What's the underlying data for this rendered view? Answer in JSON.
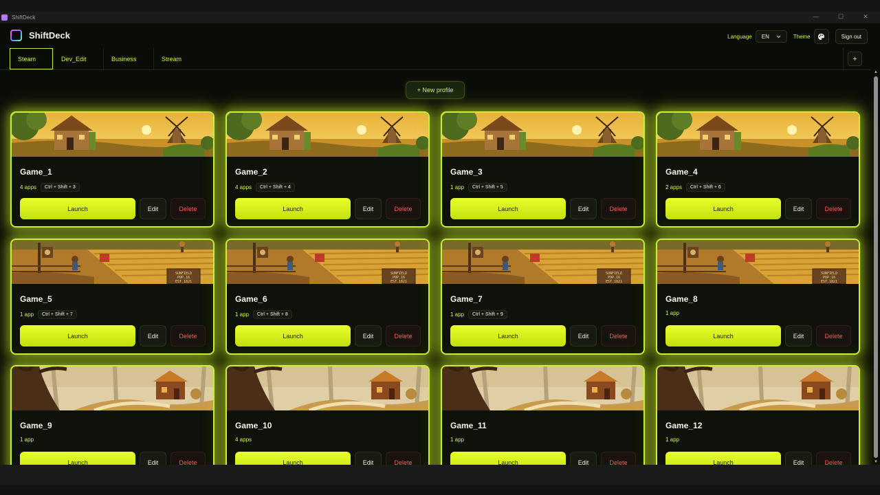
{
  "window": {
    "title": "ShiftDeck",
    "controls": [
      "—",
      "☐",
      "✕"
    ]
  },
  "header": {
    "brand": "ShiftDeck",
    "language_label": "Language",
    "language_value": "EN",
    "theme_label": "Theme",
    "signout_label": "Sign out"
  },
  "tabs": [
    {
      "label": "Steam",
      "active": true
    },
    {
      "label": "Dev_Edit",
      "active": false
    },
    {
      "label": "Business",
      "active": false
    },
    {
      "label": "Stream",
      "active": false
    }
  ],
  "add_tab_label": "+",
  "new_profile_label": "+ New profile",
  "card_buttons": {
    "launch": "Launch",
    "edit": "Edit",
    "delete": "Delete"
  },
  "cards": [
    {
      "title": "Game_1",
      "apps": "4 apps",
      "shortcut": "Ctrl + Shift + 3",
      "scene": "cottage"
    },
    {
      "title": "Game_2",
      "apps": "4 apps",
      "shortcut": "Ctrl + Shift + 4",
      "scene": "cottage"
    },
    {
      "title": "Game_3",
      "apps": "1 app",
      "shortcut": "Ctrl + Shift + 5",
      "scene": "cottage"
    },
    {
      "title": "Game_4",
      "apps": "2 apps",
      "shortcut": "Ctrl + Shift + 6",
      "scene": "cottage"
    },
    {
      "title": "Game_5",
      "apps": "1 app",
      "shortcut": "Ctrl + Shift + 7",
      "scene": "farm"
    },
    {
      "title": "Game_6",
      "apps": "1 app",
      "shortcut": "Ctrl + Shift + 8",
      "scene": "farm"
    },
    {
      "title": "Game_7",
      "apps": "1 app",
      "shortcut": "Ctrl + Shift + 9",
      "scene": "farm"
    },
    {
      "title": "Game_8",
      "apps": "1 app",
      "shortcut": "",
      "scene": "farm"
    },
    {
      "title": "Game_9",
      "apps": "1 app",
      "shortcut": "",
      "scene": "forest"
    },
    {
      "title": "Game_10",
      "apps": "4 apps",
      "shortcut": "",
      "scene": "forest"
    },
    {
      "title": "Game_11",
      "apps": "1 app",
      "shortcut": "",
      "scene": "forest"
    },
    {
      "title": "Game_12",
      "apps": "1 app",
      "shortcut": "",
      "scene": "forest"
    }
  ],
  "sign_text": [
    "SUNFIELD",
    "POP.16",
    "EST.1821"
  ],
  "colors": {
    "accent": "#d7ef4a",
    "glow": "#c8f03a",
    "danger": "#f05a4a",
    "background": "#0a0c08"
  }
}
